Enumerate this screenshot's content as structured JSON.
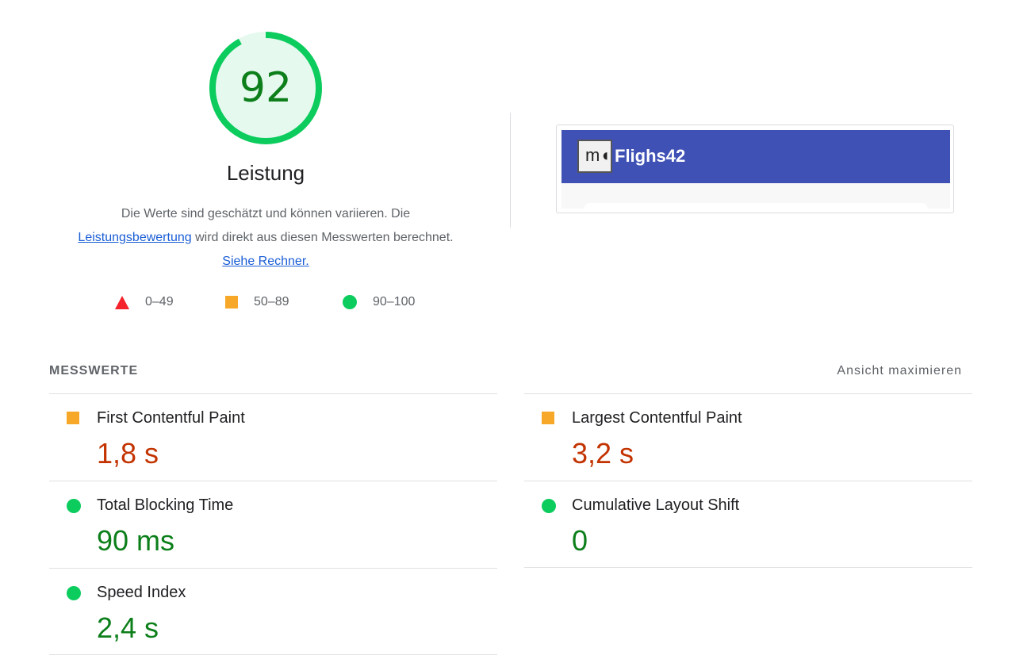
{
  "score": {
    "value": "92",
    "fraction": 0.92,
    "color": "#0ccc5e"
  },
  "category": {
    "title": "Leistung"
  },
  "description": {
    "text1": "Die Werte sind geschätzt und können variieren. Die ",
    "link1": "Leistungsbewertung",
    "text2": " wird direkt aus diesen Messwerten berechnet. ",
    "link2": "Siehe Rechner."
  },
  "legend": {
    "fail": {
      "label": "0–49",
      "color": "#f5232b",
      "icon": "triangle-icon"
    },
    "average": {
      "label": "50–89",
      "color": "#f7a828",
      "icon": "square-icon"
    },
    "pass": {
      "label": "90–100",
      "color": "#0ccc5e",
      "icon": "circle-icon"
    }
  },
  "screenshot": {
    "logo_text": "m",
    "brand": "Flighs42",
    "bar_color": "#3f51b5"
  },
  "metrics": {
    "title": "MESSWERTE",
    "expand_label": "Ansicht maximieren",
    "items": [
      {
        "name": "First Contentful Paint",
        "value": "1,8 s",
        "rating": "average"
      },
      {
        "name": "Largest Contentful Paint",
        "value": "3,2 s",
        "rating": "average"
      },
      {
        "name": "Total Blocking Time",
        "value": "90 ms",
        "rating": "pass"
      },
      {
        "name": "Cumulative Layout Shift",
        "value": "0",
        "rating": "pass"
      },
      {
        "name": "Speed Index",
        "value": "2,4 s",
        "rating": "pass"
      }
    ]
  }
}
